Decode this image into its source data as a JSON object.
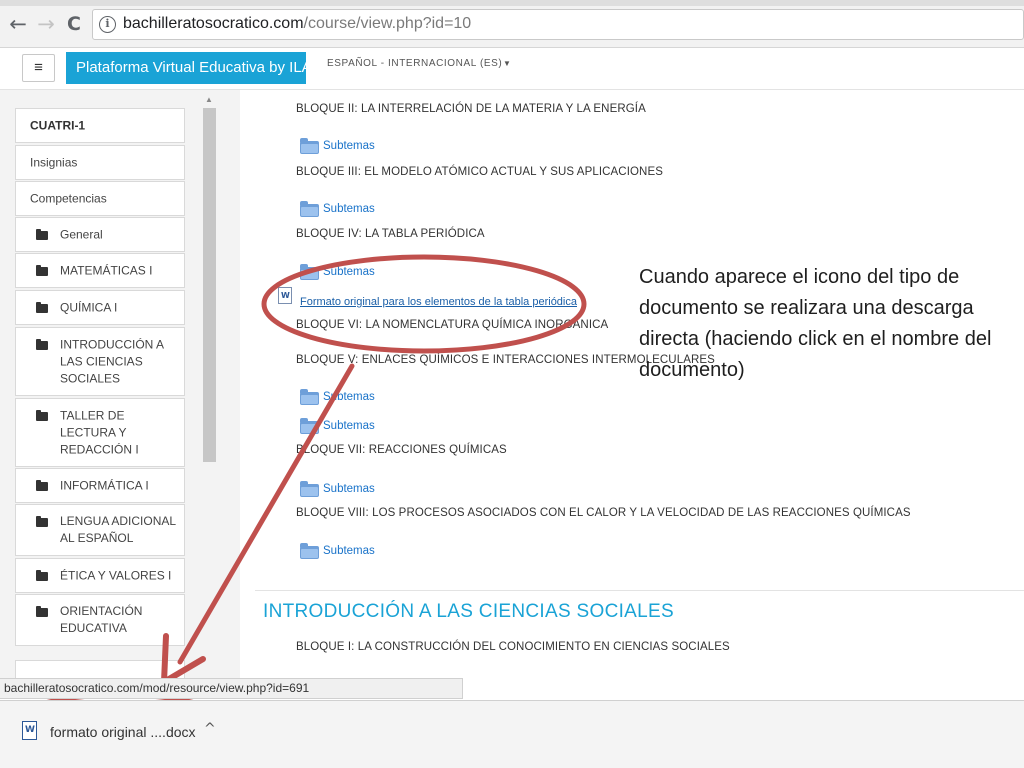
{
  "browser": {
    "url_domain": "bachilleratosocratico.com",
    "url_path": "/course/view.php?id=10",
    "back_icon": "←",
    "forward_icon": "→",
    "reload_icon": "C",
    "info_icon": "i"
  },
  "header": {
    "menu_icon": "≡",
    "brand": "Plataforma Virtual Educativa by ILAT",
    "language": "ESPAÑOL - INTERNACIONAL (ES)",
    "language_caret": "▼"
  },
  "sidebar": {
    "items": [
      {
        "label": "CUATRI-1"
      },
      {
        "label": "Insignias"
      },
      {
        "label": "Competencias"
      },
      {
        "label": "General"
      },
      {
        "label": "MATEMÁTICAS I"
      },
      {
        "label": "QUÍMICA I"
      },
      {
        "label": "INTRODUCCIÓN A LAS CIENCIAS SOCIALES"
      },
      {
        "label": "TALLER DE LECTURA Y REDACCIÓN I"
      },
      {
        "label": "INFORMÁTICA I"
      },
      {
        "label": "LENGUA ADICIONAL AL ESPAÑOL"
      },
      {
        "label": "ÉTICA Y VALORES I"
      },
      {
        "label": "ORIENTACIÓN EDUCATIVA"
      }
    ]
  },
  "main": {
    "blocks": [
      "BLOQUE II: LA INTERRELACIÓN DE LA MATERIA Y LA ENERGÍA",
      "BLOQUE III: EL MODELO  ATÓMICO ACTUAL Y SUS APLICACIONES",
      "BLOQUE IV: LA TABLA PERIÓDICA",
      "BLOQUE VI: LA NOMENCLATURA QUÍMICA INORGÁNICA",
      "BLOQUE V: ENLACES QUÍMICOS E INTERACCIONES INTERMOLECULARES",
      "BLOQUE VII: REACCIONES QUÍMICAS",
      "BLOQUE VIII: LOS PROCESOS ASOCIADOS CON EL CALOR Y LA VELOCIDAD DE LAS REACCIONES QUÍMICAS"
    ],
    "subtemas_label": "Subtemas",
    "document_link": "Formato original para los elementos de la tabla periódica",
    "doc_icon_letter": "W",
    "section_title": "INTRODUCCIÓN A LAS CIENCIAS SOCIALES",
    "section_block": "BLOQUE I: LA CONSTRUCCIÓN DEL CONOCIMIENTO EN CIENCIAS SOCIALES"
  },
  "annotation": {
    "text": "Cuando aparece el icono del tipo de documento se realizara una descarga directa (haciendo click en el nombre del documento)",
    "color": "#c0504d"
  },
  "status": {
    "url": "bachilleratosocratico.com/mod/resource/view.php?id=691"
  },
  "download": {
    "file_name": "formato original ....docx",
    "caret": "^",
    "icon_letter": "W"
  }
}
